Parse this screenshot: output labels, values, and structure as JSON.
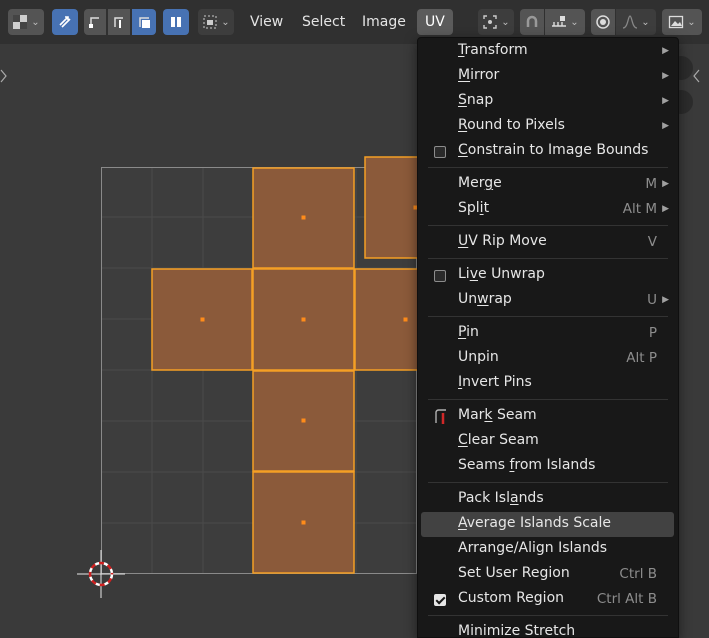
{
  "header": {
    "menus": [
      {
        "label": "View"
      },
      {
        "label": "Select"
      },
      {
        "label": "Image"
      },
      {
        "label": "UV"
      }
    ]
  },
  "uv_menu": {
    "items": [
      {
        "pre": "",
        "u": "T",
        "post": "ransform",
        "submenu": true
      },
      {
        "pre": "",
        "u": "M",
        "post": "irror",
        "submenu": true
      },
      {
        "pre": "",
        "u": "S",
        "post": "nap",
        "submenu": true
      },
      {
        "pre": "",
        "u": "R",
        "post": "ound to Pixels",
        "submenu": true
      },
      {
        "pre": "",
        "u": "C",
        "post": "onstrain to Image Bounds",
        "checkbox": true,
        "checked": false
      },
      {
        "pre": "Mer",
        "u": "g",
        "post": "e",
        "shortcut": "M",
        "submenu": true
      },
      {
        "pre": "Spl",
        "u": "i",
        "post": "t",
        "shortcut": "Alt M",
        "submenu": true
      },
      {
        "pre": "",
        "u": "U",
        "post": "V Rip Move",
        "shortcut": "V"
      },
      {
        "pre": "Li",
        "u": "v",
        "post": "e Unwrap",
        "checkbox": true,
        "checked": false
      },
      {
        "pre": "Un",
        "u": "w",
        "post": "rap",
        "shortcut": "U",
        "submenu": true
      },
      {
        "pre": "",
        "u": "P",
        "post": "in",
        "shortcut": "P"
      },
      {
        "pre": "Unpin",
        "u": "",
        "post": "",
        "shortcut": "Alt P"
      },
      {
        "pre": "",
        "u": "I",
        "post": "nvert Pins"
      },
      {
        "pre": "Mar",
        "u": "k",
        "post": " Seam",
        "icon": "mark-seam-icon"
      },
      {
        "pre": "",
        "u": "C",
        "post": "lear Seam"
      },
      {
        "pre": "Seams ",
        "u": "f",
        "post": "rom Islands"
      },
      {
        "pre": "Pack Isl",
        "u": "a",
        "post": "nds"
      },
      {
        "pre": "",
        "u": "A",
        "post": "verage Islands Scale",
        "highlighted": true
      },
      {
        "pre": "Arrange/Align Islands",
        "u": "",
        "post": ""
      },
      {
        "pre": "Set User Region",
        "u": "",
        "post": "",
        "shortcut": "Ctrl B"
      },
      {
        "pre": "Custom Region",
        "u": "",
        "post": "",
        "shortcut": "Ctrl Alt B",
        "checkbox": true,
        "checked": true
      },
      {
        "pre": "Minimize Stretch",
        "u": "",
        "post": ""
      }
    ]
  },
  "colors": {
    "accent": "#4772b3",
    "face_fill": "#8b5a3a",
    "face_edge": "#f59f24",
    "header_bg": "#303030",
    "menu_bg": "#181818",
    "highlight": "#424242",
    "viewport_bg": "#3a3a3a"
  }
}
